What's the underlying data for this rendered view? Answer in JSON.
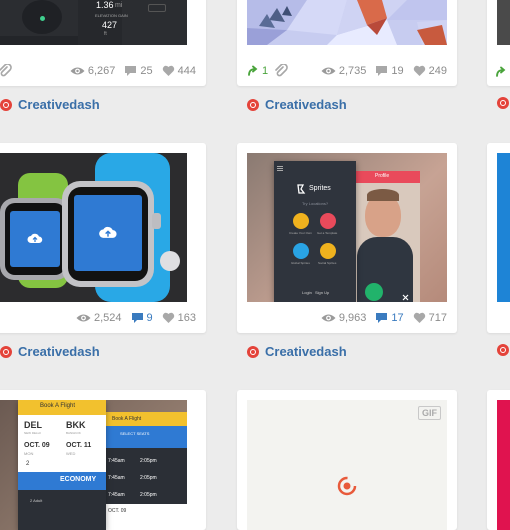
{
  "cards": [
    {
      "author": "Creativedash",
      "views": "6,267",
      "comments": "25",
      "likes": "444",
      "mock": {
        "time": "1.36",
        "unit": "mi",
        "subtitle": "ELEVATION GAIN",
        "value": "427",
        "metric": "ft"
      }
    },
    {
      "author": "Creativedash",
      "rebounds": "1",
      "views": "2,735",
      "comments": "19",
      "likes": "249"
    },
    {
      "author": "Creativedash",
      "views": "2,524",
      "comments": "9",
      "likes": "163"
    },
    {
      "author": "Creativedash",
      "views": "9,963",
      "comments": "17",
      "likes": "717",
      "mock": {
        "app_title": "Sprites",
        "hint": "Try Locations?",
        "labels": [
          "Create Your Own",
          "Get a Template",
          "Global Sprites",
          "Social Sprites"
        ],
        "login": "Login",
        "signup": "Sign Up",
        "tab": "Profile"
      }
    },
    {
      "mock": {
        "header": "Book A Flight",
        "from_code": "DEL",
        "from_city": "NEW DELHI",
        "to_code": "BKK",
        "to_city": "BANGKOK",
        "depart": "OCT. 09",
        "depart_day": "MON",
        "return": "OCT. 11",
        "return_day": "WED",
        "passengers": "2",
        "class": "ECONOMY",
        "adults": "2 Adult",
        "back_header": "Book A Flight",
        "select": "SELECT SEATS",
        "times": [
          "7:45am",
          "7:45am",
          "7:45am"
        ],
        "arrivals": [
          "2:05pm",
          "2:05pm",
          "2:05pm"
        ],
        "date": "OCT. 09"
      }
    },
    {
      "gif": "GIF"
    }
  ],
  "colors": {
    "link": "#3a6fa8",
    "brand": "#e4433a",
    "meta": "#8c8c8c"
  }
}
